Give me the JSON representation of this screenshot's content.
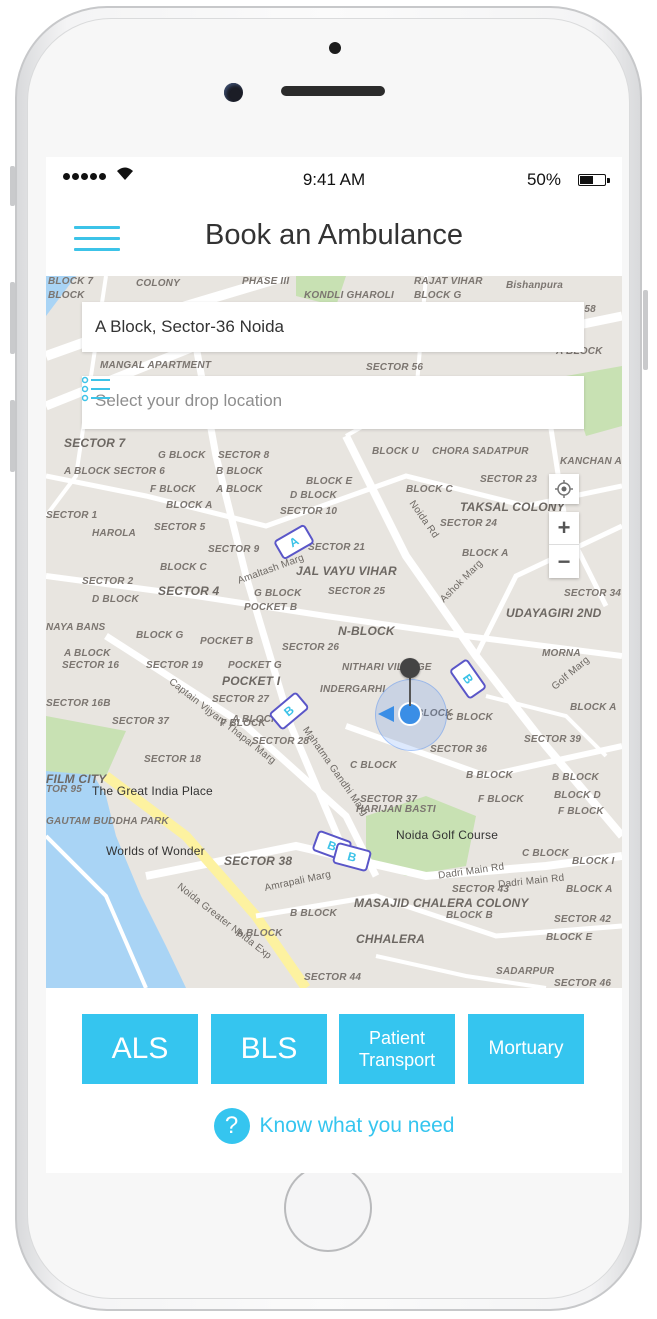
{
  "status_bar": {
    "time": "9:41 AM",
    "battery": "50%"
  },
  "header": {
    "title": "Book an Ambulance"
  },
  "pickup": {
    "value": "A Block, Sector-36 Noida"
  },
  "drop": {
    "placeholder": "Select your drop location"
  },
  "map": {
    "labels": [
      "BLOCK 7",
      "COLONY",
      "PHASE III",
      "RAJAT VIHAR",
      "Bishanpura",
      "BLOCK",
      "KONDLI GHAROLI",
      "BLOCK G",
      "R 58",
      "MANGAL APARTMENT",
      "SECTOR 56",
      "A BLOCK",
      "SECTOR 7",
      "G BLOCK",
      "SECTOR 8",
      "BLOCK U",
      "CHORA SADATPUR",
      "KANCHAN APARTM",
      "A BLOCK SECTOR 6",
      "B BLOCK",
      "BLOCK E",
      "BLOCK C",
      "SECTOR 23",
      "F BLOCK",
      "A BLOCK",
      "D BLOCK",
      "TAKSAL COLONY",
      "BLOCK A",
      "SECTOR 10",
      "SECTOR 24",
      "SECTOR 1",
      "SECTOR 5",
      "HAROLA",
      "SECTOR 9",
      "SECTOR 21",
      "BLOCK A",
      "BLOCK C",
      "JAL VAYU VIHAR",
      "SECTOR 2",
      "SECTOR 4",
      "G BLOCK",
      "SECTOR 25",
      "SECTOR 34",
      "D BLOCK",
      "POCKET B",
      "UDAYAGIRI 2ND",
      "NAYA BANS",
      "N-BLOCK",
      "BLOCK G",
      "POCKET B",
      "SECTOR 26",
      "A BLOCK",
      "MORNA",
      "SECTOR 16",
      "SECTOR 19",
      "POCKET G",
      "NITHARI VILLAGE",
      "POCKET I",
      "INDERGARHI",
      "SECTOR 16B",
      "SECTOR 27",
      "A BLOCK",
      "BLOCK",
      "C BLOCK",
      "BLOCK A",
      "SECTOR 37",
      "F BLOCK",
      "SECTOR 28",
      "SECTOR 36",
      "SECTOR 39",
      "FILM CITY",
      "SECTOR 18",
      "C BLOCK",
      "B BLOCK",
      "B BLOCK",
      "TOR 95",
      "BLOCK D",
      "SECTOR 37",
      "HARIJAN BASTI",
      "F BLOCK",
      "GAUTAM BUDDHA PARK",
      "F BLOCK",
      "SECTOR 38",
      "C BLOCK",
      "BLOCK I",
      "MASAJID CHALERA COLONY",
      "SECTOR 43",
      "BLOCK A",
      "B BLOCK",
      "BLOCK B",
      "SECTOR 42",
      "A BLOCK",
      "CHHALERA",
      "BLOCK E",
      "SECTOR 44",
      "SADARPUR",
      "SECTOR 46"
    ],
    "places": [
      "The Great India Place",
      "Worlds of Wonder",
      "Noida Golf Course"
    ],
    "roads": [
      "Noida Greater Noida Exp",
      "Amrapali Marg",
      "Dadri Main Rd",
      "Noida Rd",
      "Golf Marg",
      "Captain Vijyant Thapar Marg",
      "Ashok Marg",
      "Amaltash Marg",
      "Mahatma Gandhi Marg",
      "Dadri Main Rd"
    ],
    "zoom_in": "+",
    "zoom_out": "−",
    "ambulances": [
      "A",
      "B",
      "B",
      "B",
      "B"
    ]
  },
  "services": [
    {
      "label": "ALS"
    },
    {
      "label": "BLS"
    },
    {
      "line1": "Patient",
      "line2": "Transport"
    },
    {
      "label": "Mortuary"
    }
  ],
  "help": {
    "icon": "?",
    "label": "Know what you need"
  },
  "colors": {
    "accent": "#35c5ef",
    "text": "#333333",
    "map_bg": "#e8e5e0"
  }
}
